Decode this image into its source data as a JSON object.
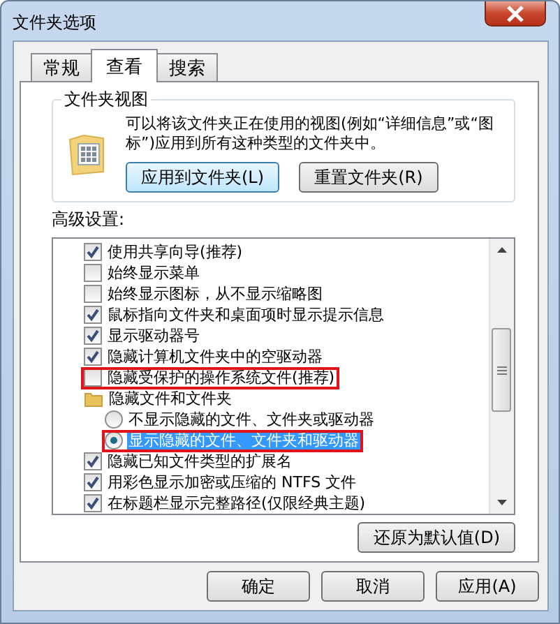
{
  "window": {
    "title": "文件夹选项"
  },
  "tabs": [
    {
      "label": "常规",
      "selected": false
    },
    {
      "label": "查看",
      "selected": true
    },
    {
      "label": "搜索",
      "selected": false
    }
  ],
  "folder_views": {
    "legend": "文件夹视图",
    "description": "可以将该文件夹正在使用的视图(例如“详细信息”或“图标”)应用到所有这种类型的文件夹中。",
    "buttons": [
      {
        "label": "应用到文件夹(L)",
        "focused": true
      },
      {
        "label": "重置文件夹(R)",
        "focused": false
      }
    ]
  },
  "advanced": {
    "label": "高级设置:",
    "items": [
      {
        "kind": "checkbox",
        "label": "使用共享向导(推荐)",
        "checked": true,
        "highlighted": false
      },
      {
        "kind": "checkbox",
        "label": "始终显示菜单",
        "checked": false,
        "highlighted": false
      },
      {
        "kind": "checkbox",
        "label": "始终显示图标，从不显示缩略图",
        "checked": false,
        "highlighted": false
      },
      {
        "kind": "checkbox",
        "label": "鼠标指向文件夹和桌面项时显示提示信息",
        "checked": true,
        "highlighted": false
      },
      {
        "kind": "checkbox",
        "label": "显示驱动器号",
        "checked": true,
        "highlighted": false
      },
      {
        "kind": "checkbox",
        "label": "隐藏计算机文件夹中的空驱动器",
        "checked": true,
        "highlighted": false
      },
      {
        "kind": "checkbox",
        "label": "隐藏受保护的操作系统文件(推荐)",
        "checked": false,
        "highlighted": true
      },
      {
        "kind": "folder",
        "label": "隐藏文件和文件夹",
        "highlighted": false,
        "children": [
          {
            "kind": "radio",
            "label": "不显示隐藏的文件、文件夹或驱动器",
            "checked": false,
            "focused": false,
            "highlighted": false
          },
          {
            "kind": "radio",
            "label": "显示隐藏的文件、文件夹和驱动器",
            "checked": true,
            "focused": true,
            "highlighted": true
          }
        ]
      },
      {
        "kind": "checkbox",
        "label": "隐藏已知文件类型的扩展名",
        "checked": true,
        "highlighted": false
      },
      {
        "kind": "checkbox",
        "label": "用彩色显示加密或压缩的 NTFS 文件",
        "checked": true,
        "highlighted": false
      },
      {
        "kind": "checkbox",
        "label": "在标题栏显示完整路径(仅限经典主题)",
        "checked": true,
        "highlighted": false
      }
    ]
  },
  "restore_button": "还原为默认值(D)",
  "buttons": [
    "确定",
    "取消",
    "应用(A)"
  ]
}
